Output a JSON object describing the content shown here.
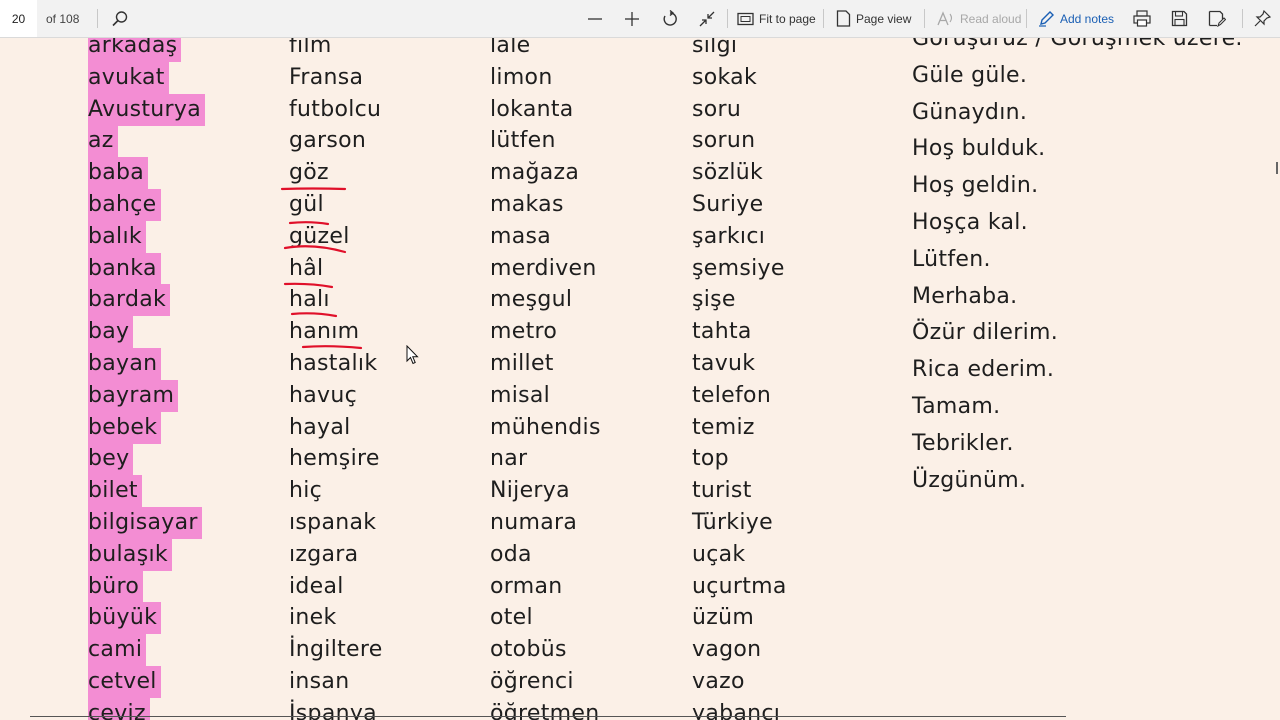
{
  "toolbar": {
    "page_number": "20",
    "page_count_label": "of 108",
    "fit_label": "Fit to page",
    "page_view_label": "Page view",
    "read_aloud_label": "Read aloud",
    "add_notes_label": "Add notes"
  },
  "columns": [
    [
      "arkadaş",
      "avukat",
      "Avusturya",
      "az",
      "baba",
      "bahçe",
      "balık",
      "banka",
      "bardak",
      "bay",
      "bayan",
      "bayram",
      "bebek",
      "bey",
      "bilet",
      "bilgisayar",
      "bulaşık",
      "büro",
      "büyük",
      "cami",
      "cetvel",
      "ceviz"
    ],
    [
      "film",
      "Fransa",
      "futbolcu",
      "garson",
      "göz",
      "gül",
      "güzel",
      "hâl",
      "halı",
      "hanım",
      "hastalık",
      "havuç",
      "hayal",
      "hemşire",
      "hiç",
      "ıspanak",
      "ızgara",
      "ideal",
      "inek",
      "İngiltere",
      "insan",
      "İspanya"
    ],
    [
      "lale",
      "limon",
      "lokanta",
      "lütfen",
      "mağaza",
      "makas",
      "masa",
      "merdiven",
      "meşgul",
      "metro",
      "millet",
      "misal",
      "mühendis",
      "nar",
      "Nijerya",
      "numara",
      "oda",
      "orman",
      "otel",
      "otobüs",
      "öğrenci",
      "öğretmen"
    ],
    [
      "silgi",
      "sokak",
      "soru",
      "sorun",
      "sözlük",
      "Suriye",
      "şarkıcı",
      "şemsiye",
      "şişe",
      "tahta",
      "tavuk",
      "telefon",
      "temiz",
      "top",
      "turist",
      "Türkiye",
      "uçak",
      "uçurtma",
      "üzüm",
      "vagon",
      "vazo",
      "yabancı"
    ]
  ],
  "phrases": [
    "Görüşürüz / Görüşmek üzere.",
    "Güle güle.",
    "Günaydın.",
    "Hoş bulduk.",
    "Hoş geldin.",
    "Hoşça kal.",
    "Lütfen.",
    "Merhaba.",
    "Özür dilerim.",
    "Rica ederim.",
    "Tamam.",
    "Tebrikler.",
    "Üzgünüm."
  ],
  "colors": {
    "highlight": "#f38dd3",
    "ink": "#e0102a",
    "page": "#fbf0e7",
    "accent": "#1a5fb4"
  }
}
